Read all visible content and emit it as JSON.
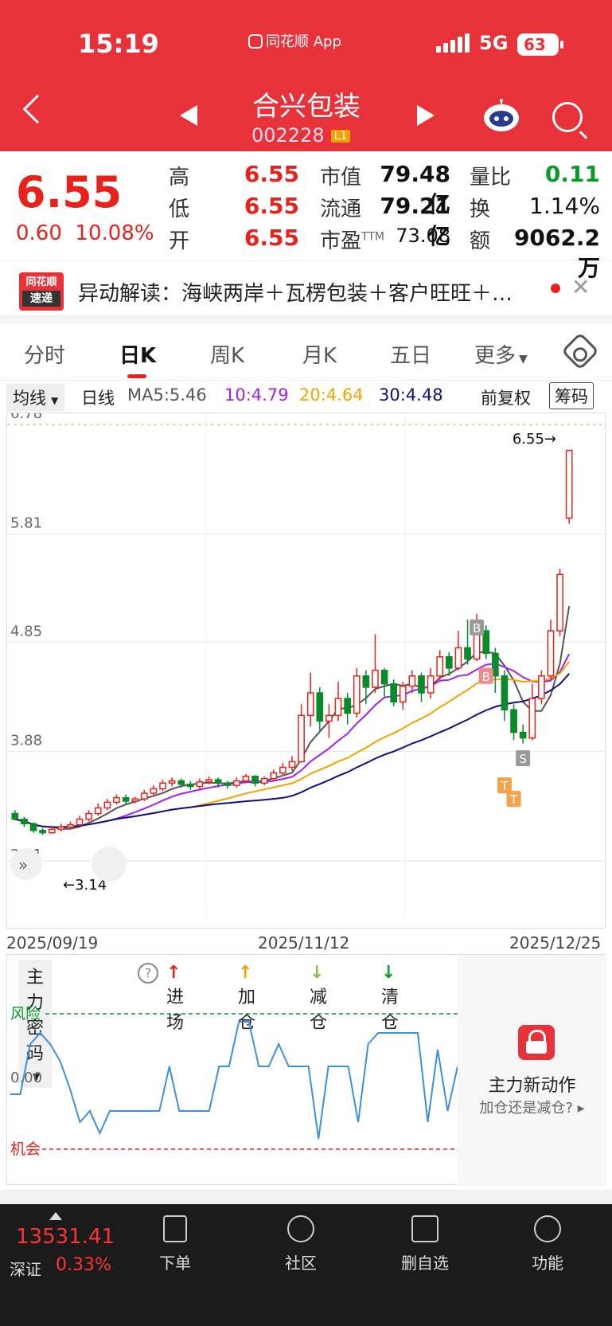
{
  "status_bar": {
    "time": "15:19",
    "app_label": "同花顺 App",
    "network": "5G",
    "battery": "63"
  },
  "header": {
    "stock_name": "合兴包装",
    "stock_code": "002228",
    "level": "L1"
  },
  "quote": {
    "price": "6.55",
    "change": "0.60",
    "change_pct": "10.08%",
    "high_label": "高",
    "high": "6.55",
    "low_label": "低",
    "low": "6.55",
    "open_label": "开",
    "open": "6.55",
    "mcap_label": "市值",
    "mcap": "79.48亿",
    "float_label": "流通",
    "float": "79.21亿",
    "pe_label": "市盈",
    "pe_sup": "TTM",
    "pe": "73.08",
    "vr_label": "量比",
    "vr": "0.11",
    "turn_label": "换",
    "turn": "1.14%",
    "amt_label": "额",
    "amt": "9062.2万"
  },
  "news": {
    "logo_top": "同花顺",
    "logo_bottom": "速递",
    "text": "异动解读：海峡两岸＋瓦楞包装＋客户旺旺＋…"
  },
  "tabs": [
    "分时",
    "日K",
    "周K",
    "月K",
    "五日",
    "更多"
  ],
  "ma_bar": {
    "select": "均线",
    "period": "日线",
    "ma5": "MA5:5.46",
    "ma10": "10:4.79",
    "ma20": "20:4.64",
    "ma30": "30:4.48",
    "adjust": "前复权",
    "chips_btn": "筹码",
    "colors": {
      "ma5": "#555555",
      "ma10": "#a020f0",
      "ma20": "#f5a300",
      "ma30": "#101080"
    }
  },
  "chart_data": {
    "type": "candlestick",
    "y_ticks": [
      "6.78",
      "5.81",
      "4.85",
      "3.88",
      "2.91"
    ],
    "ylim": [
      2.91,
      6.78
    ],
    "x_labels": [
      "2025/09/19",
      "2025/11/12",
      "2025/12/25"
    ],
    "last_label": "6.55→",
    "min_label": "←3.14",
    "markers": {
      "buy": "B",
      "sell": "S",
      "t": "T"
    },
    "candles": [
      [
        3.33,
        3.28,
        3.36,
        3.27
      ],
      [
        3.28,
        3.24,
        3.3,
        3.21
      ],
      [
        3.24,
        3.18,
        3.25,
        3.16
      ],
      [
        3.18,
        3.16,
        3.2,
        3.14
      ],
      [
        3.16,
        3.19,
        3.22,
        3.15
      ],
      [
        3.19,
        3.21,
        3.24,
        3.17
      ],
      [
        3.21,
        3.23,
        3.26,
        3.19
      ],
      [
        3.23,
        3.28,
        3.31,
        3.22
      ],
      [
        3.28,
        3.33,
        3.36,
        3.26
      ],
      [
        3.33,
        3.38,
        3.42,
        3.31
      ],
      [
        3.38,
        3.43,
        3.46,
        3.36
      ],
      [
        3.43,
        3.47,
        3.5,
        3.41
      ],
      [
        3.47,
        3.44,
        3.5,
        3.41
      ],
      [
        3.44,
        3.46,
        3.48,
        3.42
      ],
      [
        3.46,
        3.51,
        3.54,
        3.44
      ],
      [
        3.51,
        3.55,
        3.58,
        3.49
      ],
      [
        3.55,
        3.6,
        3.63,
        3.53
      ],
      [
        3.6,
        3.62,
        3.65,
        3.57
      ],
      [
        3.62,
        3.59,
        3.64,
        3.56
      ],
      [
        3.59,
        3.57,
        3.62,
        3.54
      ],
      [
        3.57,
        3.61,
        3.64,
        3.55
      ],
      [
        3.61,
        3.63,
        3.66,
        3.59
      ],
      [
        3.63,
        3.6,
        3.65,
        3.56
      ],
      [
        3.6,
        3.58,
        3.62,
        3.55
      ],
      [
        3.58,
        3.62,
        3.65,
        3.56
      ],
      [
        3.62,
        3.66,
        3.68,
        3.6
      ],
      [
        3.66,
        3.6,
        3.67,
        3.57
      ],
      [
        3.6,
        3.64,
        3.66,
        3.58
      ],
      [
        3.64,
        3.69,
        3.72,
        3.62
      ],
      [
        3.69,
        3.74,
        3.78,
        3.67
      ],
      [
        3.74,
        3.79,
        3.84,
        3.71
      ],
      [
        3.79,
        4.2,
        4.3,
        3.78
      ],
      [
        4.2,
        4.4,
        4.58,
        4.1
      ],
      [
        4.4,
        4.15,
        4.45,
        4.05
      ],
      [
        4.15,
        4.2,
        4.3,
        4.0
      ],
      [
        4.2,
        4.35,
        4.5,
        4.15
      ],
      [
        4.35,
        4.22,
        4.4,
        4.12
      ],
      [
        4.22,
        4.55,
        4.62,
        4.18
      ],
      [
        4.55,
        4.45,
        4.6,
        4.3
      ],
      [
        4.45,
        4.6,
        4.92,
        4.4
      ],
      [
        4.6,
        4.48,
        4.62,
        4.35
      ],
      [
        4.48,
        4.32,
        4.52,
        4.28
      ],
      [
        4.32,
        4.46,
        4.5,
        4.25
      ],
      [
        4.46,
        4.55,
        4.6,
        4.4
      ],
      [
        4.55,
        4.4,
        4.58,
        4.32
      ],
      [
        4.4,
        4.55,
        4.62,
        4.35
      ],
      [
        4.55,
        4.72,
        4.78,
        4.5
      ],
      [
        4.72,
        4.62,
        4.76,
        4.55
      ],
      [
        4.62,
        4.8,
        4.95,
        4.6
      ],
      [
        4.8,
        4.7,
        5.05,
        4.65
      ],
      [
        4.7,
        4.95,
        5.1,
        4.68
      ],
      [
        4.95,
        4.75,
        5.0,
        4.7
      ],
      [
        4.75,
        4.55,
        4.8,
        4.4
      ],
      [
        4.55,
        4.25,
        4.6,
        4.15
      ],
      [
        4.25,
        4.05,
        4.3,
        3.98
      ],
      [
        4.05,
        4.0,
        4.12,
        3.95
      ],
      [
        4.0,
        4.35,
        4.48,
        3.98
      ],
      [
        4.35,
        4.55,
        4.6,
        4.3
      ],
      [
        4.55,
        4.95,
        5.05,
        4.5
      ],
      [
        4.95,
        5.45,
        5.5,
        4.9
      ],
      [
        5.95,
        6.55,
        6.55,
        5.9
      ]
    ]
  },
  "indicator": {
    "select": "主力密码",
    "help": "?",
    "legend": [
      {
        "label": "进场",
        "color": "#e8221b"
      },
      {
        "label": "加仓",
        "color": "#f5a300"
      },
      {
        "label": "减仓",
        "color": "#8bc34a"
      },
      {
        "label": "清仓",
        "color": "#0a9a2a"
      }
    ],
    "risk_label": "风险",
    "zero_label": "0.00",
    "chance_label": "机会",
    "values": [
      -0.3,
      -0.3,
      0.6,
      0.8,
      0.6,
      0.3,
      -0.2,
      -0.8,
      -0.6,
      -1.0,
      -0.6,
      -0.6,
      -0.6,
      -0.6,
      -0.6,
      -0.6,
      0.2,
      -0.6,
      -0.6,
      -0.6,
      -0.6,
      0.2,
      0.2,
      1.0,
      1.0,
      0.2,
      0.2,
      0.6,
      0.2,
      0.2,
      0.2,
      -1.1,
      0.2,
      0.2,
      0.2,
      -0.8,
      0.6,
      0.8,
      0.8,
      0.8,
      0.8,
      0.8,
      -0.8,
      0.5,
      -0.6,
      0.2
    ],
    "promo_title": "主力新动作",
    "promo_sub": "加仓还是减仓?"
  },
  "bottom": {
    "index_value": "13531.41",
    "index_name": "深证",
    "index_pct": "0.33%",
    "nav": [
      "下单",
      "社区",
      "删自选",
      "功能"
    ]
  }
}
